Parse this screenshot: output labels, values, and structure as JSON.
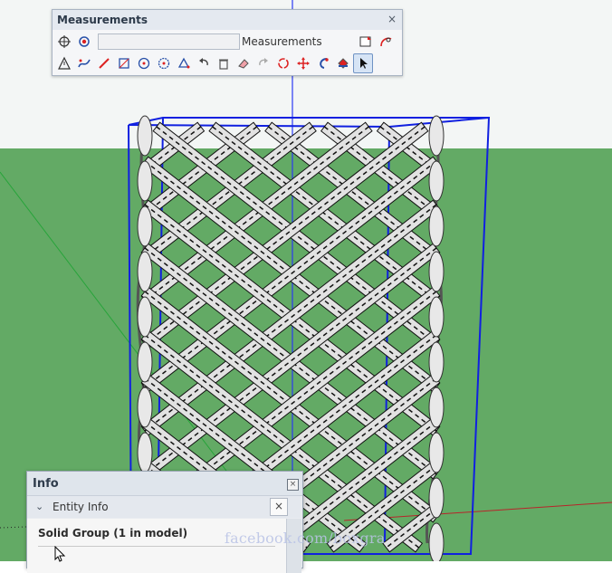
{
  "toolbar": {
    "title": "Measurements",
    "close_glyph": "×",
    "input_value": "",
    "label": "Measurements"
  },
  "info": {
    "title": "Info",
    "close_glyph": "×",
    "section_title": "Entity Info",
    "section_close_glyph": "×",
    "chevron_glyph": "⌄",
    "entity_name": "Solid Group (1 in model)"
  },
  "watermark": "facebook.com/boxgra",
  "colors": {
    "sky": "#f3f6f5",
    "ground": "#63aa65",
    "selection_box": "#1020e0",
    "blue_axis": "#2b3af2",
    "green_axis": "#27a43a",
    "red_axis": "#b8242a",
    "lattice_fill": "#d8d8d8",
    "lattice_edge": "#111111"
  },
  "icons": {
    "row1": [
      "crosshair-icon",
      "target-point-icon"
    ],
    "row1_right": [
      "section-plane-icon",
      "arc-tool-icon"
    ],
    "row2": [
      "warning-triangle-icon",
      "wave-tool-icon",
      "pencil-icon",
      "rectangle-tool-icon",
      "circle-tool-icon",
      "polygon-tool-icon",
      "protractor-icon",
      "undo-icon",
      "trash-icon",
      "eraser-icon",
      "redo-icon",
      "rotate-icon",
      "move-icon",
      "follow-me-icon",
      "paint-bucket-icon",
      "select-arrow-icon"
    ]
  }
}
